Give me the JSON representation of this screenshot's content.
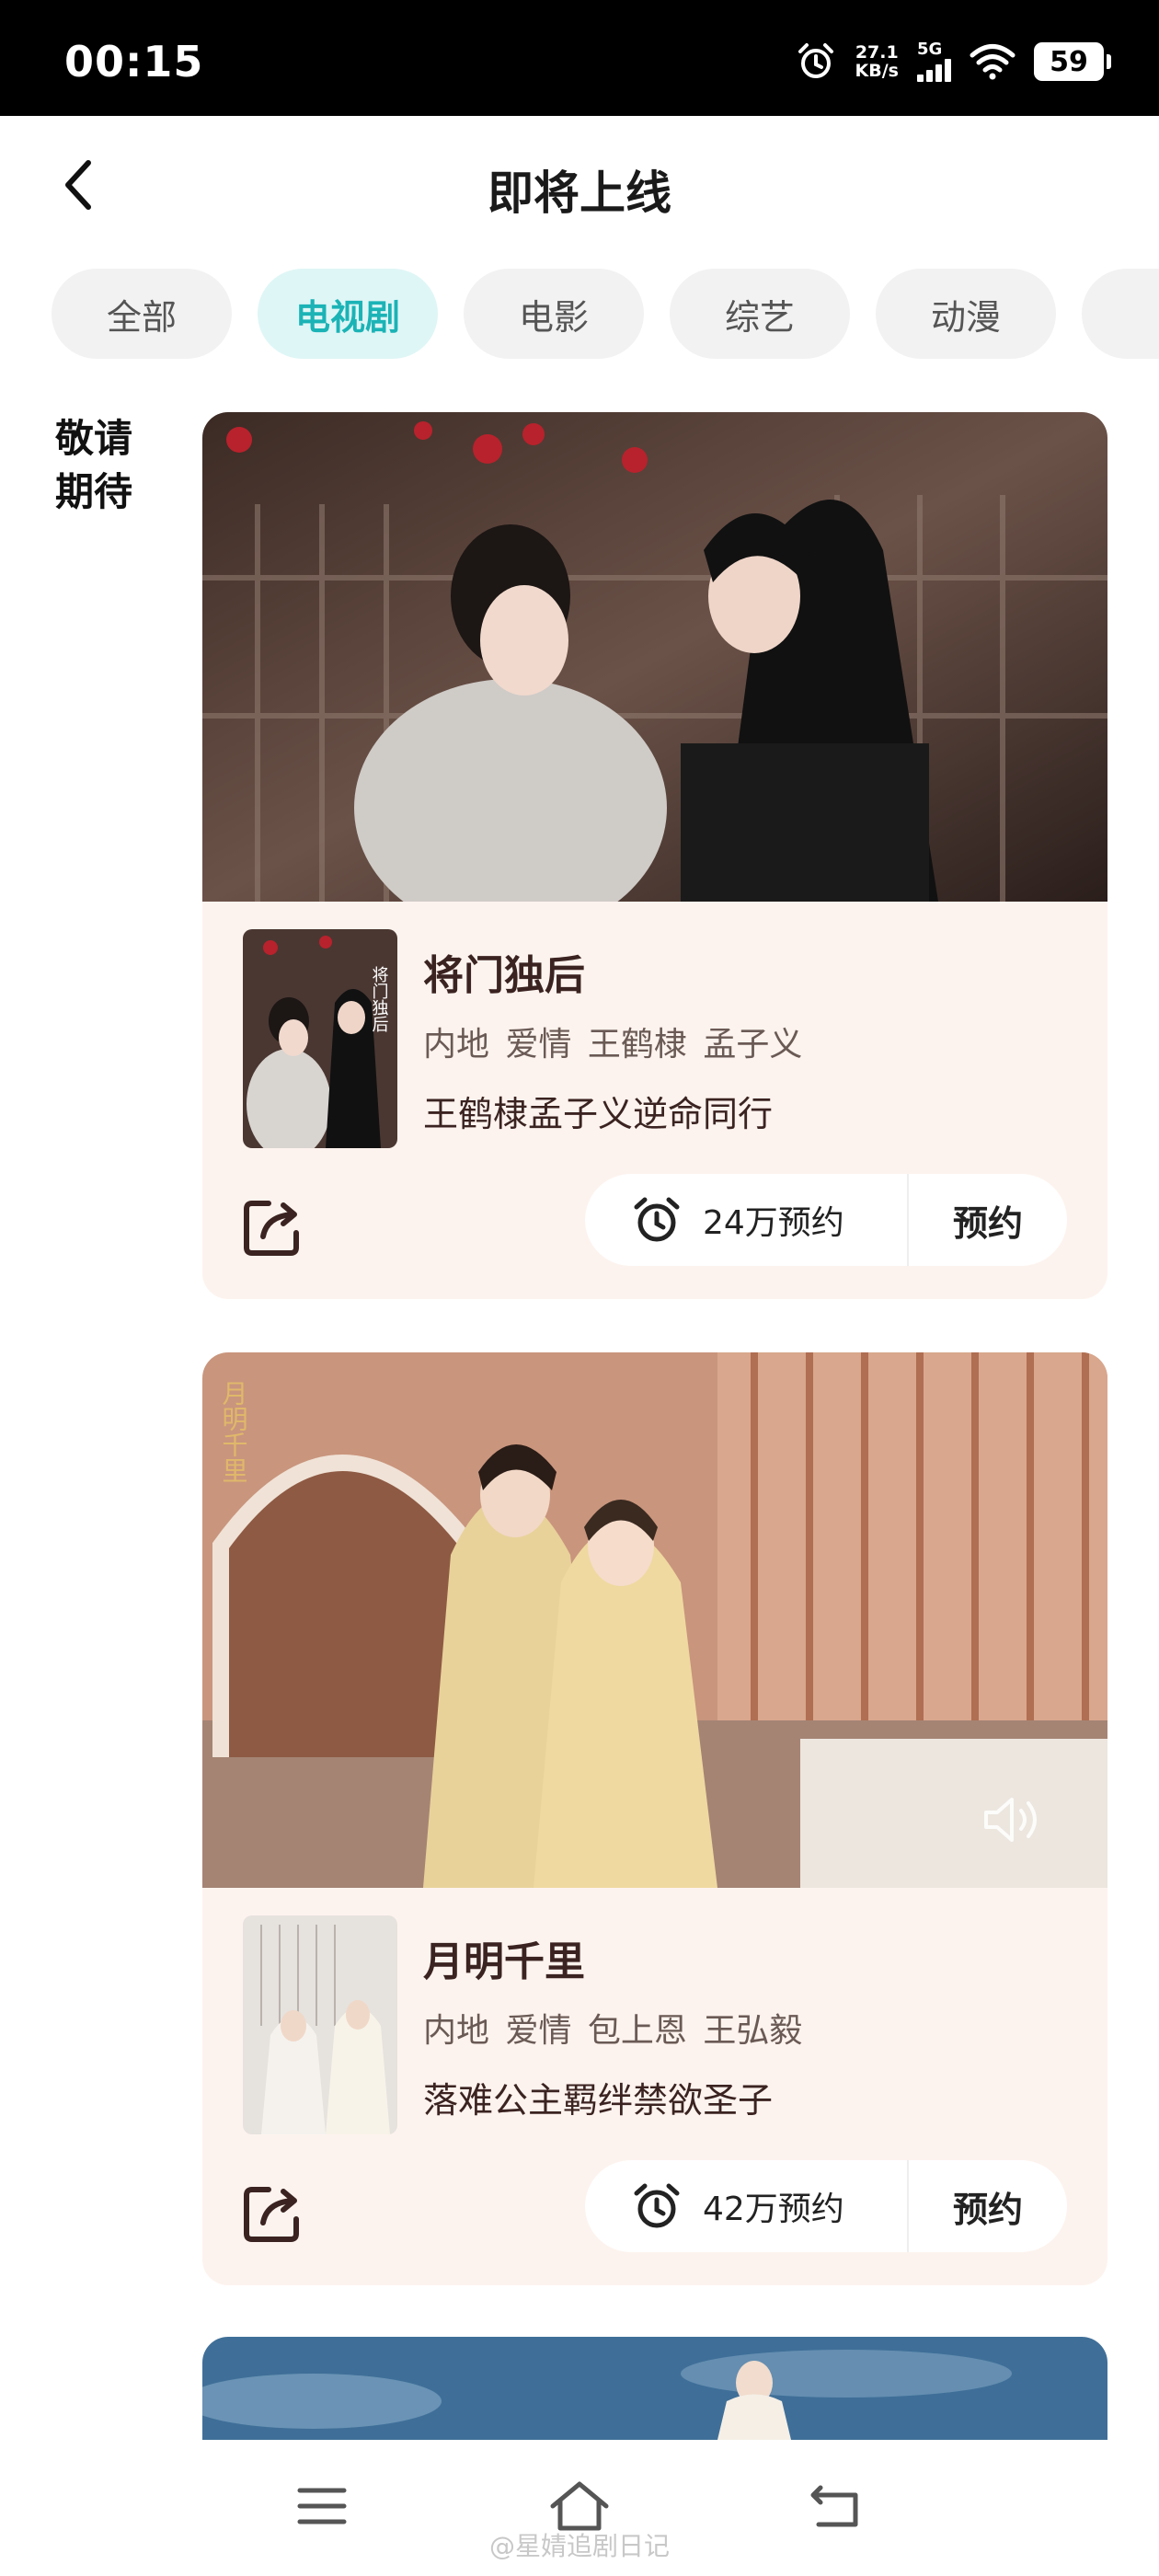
{
  "status_bar": {
    "time": "00:15",
    "net_speed": "27.1",
    "net_unit": "KB/s",
    "network": "5G",
    "battery": "59"
  },
  "header": {
    "title": "即将上线"
  },
  "tabs": [
    {
      "label": "全部",
      "active": false
    },
    {
      "label": "电视剧",
      "active": true
    },
    {
      "label": "电影",
      "active": false
    },
    {
      "label": "综艺",
      "active": false
    },
    {
      "label": "动漫",
      "active": false
    }
  ],
  "section_label": "敬请期待",
  "cards": [
    {
      "title": "将门独后",
      "tags": "内地 爱情 王鹤棣 孟子义",
      "description": "王鹤棣孟子义逆命同行",
      "reserve_count": "24万预约",
      "reserve_button": "预约",
      "poster_text": "将门独后"
    },
    {
      "title": "月明千里",
      "tags": "内地 爱情 包上恩 王弘毅",
      "description": "落难公主羁绊禁欲圣子",
      "reserve_count": "42万预约",
      "reserve_button": "预约",
      "banner_logo": "月明千里"
    }
  ],
  "watermark": "@星婧追剧日记",
  "icons": {
    "back": "back-arrow-icon",
    "share": "share-icon",
    "alarm": "alarm-clock-icon",
    "volume": "volume-icon",
    "menu": "menu-icon",
    "home": "home-icon",
    "return": "return-icon"
  }
}
